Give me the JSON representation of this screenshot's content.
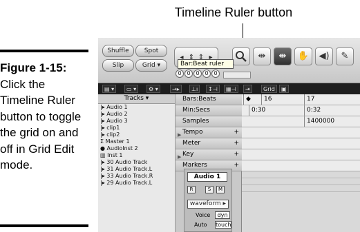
{
  "callout": {
    "label": "Timeline Ruler button"
  },
  "caption": {
    "figure_label": "Figure 1-15:",
    "text": "Click the Timeline Ruler button to toggle the grid on and off in Grid Edit mode."
  },
  "toolbar": {
    "modes": [
      "Shuffle",
      "Spot",
      "Slip",
      "Grid"
    ],
    "counters": [
      "0",
      "0",
      "0",
      "0",
      "0"
    ],
    "tools": [
      "zoom-icon",
      "trim-icon",
      "selector-icon",
      "grabber-icon",
      "speaker-icon",
      "pencil-icon"
    ]
  },
  "darkbar": {
    "items": [
      "Grid",
      "Bars:Beats"
    ]
  },
  "tracks": {
    "header": "Tracks",
    "items": [
      "Audio 1",
      "Audio 2",
      "Audio 3",
      "clip1",
      "clip2",
      "Master 1",
      "AudioInst 2",
      "Inst 1",
      "30 Audio Track",
      "31 Audio Track.L",
      "33 Audio Track.R",
      "29 Audio Track.L"
    ]
  },
  "rulers": {
    "rows": [
      "Bars:Beats",
      "Min:Secs",
      "Samples",
      "Tempo",
      "Meter",
      "Key",
      "Markers"
    ],
    "tooltip": "Bar:Beat ruler"
  },
  "strip": {
    "name": "Audio 1",
    "rec": "R",
    "solo": "S",
    "mute": "M",
    "view": "waveform",
    "voice_label": "Voice",
    "voice_value": "dyn",
    "auto_label": "Auto",
    "auto_value": "touch"
  },
  "timeline": {
    "bars": [
      "16",
      "17"
    ],
    "mins": [
      "0:30",
      "0:32"
    ],
    "samples": "1400000"
  }
}
